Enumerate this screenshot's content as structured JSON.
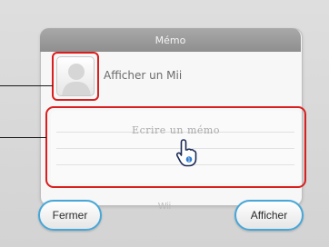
{
  "dialog": {
    "title": "Mémo",
    "show_mii_label": "Afficher un Mii",
    "memo_placeholder": "Ecrire un mémo",
    "center_label": "Wii"
  },
  "buttons": {
    "close_label": "Fermer",
    "show_label": "Afficher"
  },
  "colors": {
    "highlight": "#d91f1f",
    "button_border": "#46a7d8",
    "titlebar": "#9a9a9a"
  },
  "icons": {
    "avatar": "mii-silhouette-icon",
    "cursor": "wii-hand-pointer-icon"
  }
}
